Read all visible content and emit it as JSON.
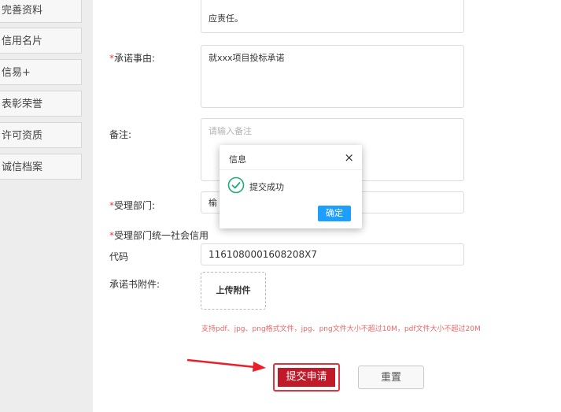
{
  "sidebar": {
    "items": [
      {
        "label": "完善资料"
      },
      {
        "label": "信用名片"
      },
      {
        "label": "信易+"
      },
      {
        "label": "表彰荣誉"
      },
      {
        "label": "许可资质"
      },
      {
        "label": "诚信档案"
      }
    ]
  },
  "form": {
    "top_text": "应责任。",
    "commitment_label": "承诺事由:",
    "commitment_value": "就xxx项目投标承诺",
    "remark_label": "备注:",
    "remark_placeholder": "请输入备注",
    "dept_label": "受理部门:",
    "dept_value": "榆",
    "credit_code_label_line1": "受理部门统一社会信用",
    "credit_code_label_line2": "代码",
    "credit_code_value": "1161080001608208X7",
    "attachment_label": "承诺书附件:",
    "upload_label": "上传附件",
    "hint": "支持pdf、jpg、png格式文件，jpg、png文件大小不超过10M，pdf文件大小不超过20M",
    "required_mark": "*",
    "submit_label": "提交申请",
    "reset_label": "重置"
  },
  "dialog": {
    "title": "信息",
    "close_label": "×",
    "message": "提交成功",
    "confirm_label": "确定"
  },
  "colors": {
    "accent_red": "#c0192a",
    "dialog_blue": "#1e9fff",
    "success_green": "#1aae6f"
  }
}
